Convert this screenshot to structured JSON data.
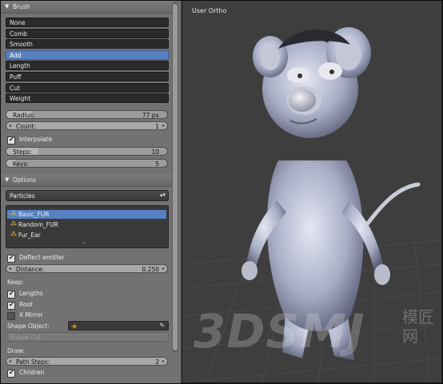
{
  "panel": {
    "brush_header": "Brush",
    "tools": [
      "None",
      "Comb",
      "Smooth",
      "Add",
      "Length",
      "Puff",
      "Cut",
      "Weight"
    ],
    "selected_tool": 3,
    "radius": {
      "label": "Radius:",
      "value": "77 px",
      "fraction": 0.16
    },
    "count": {
      "label": "Count:",
      "value": "1"
    },
    "interpolate": {
      "label": "Interpolate",
      "checked": true
    },
    "steps": {
      "label": "Steps:",
      "value": "10",
      "fraction": 0.2
    },
    "keys": {
      "label": "Keys:",
      "value": "5",
      "fraction": 0.06
    },
    "options_header": "Options",
    "mode_select": "Particles",
    "particle_systems": [
      "Basic_FUR",
      "Random_FUR",
      "Fur_Ear"
    ],
    "deflect_emitter": {
      "label": "Deflect emitter",
      "checked": true
    },
    "distance": {
      "label": "Distance:",
      "value": "0.250"
    },
    "keep_label": "Keep:",
    "lengths": {
      "label": "Lengths",
      "checked": true
    },
    "root": {
      "label": "Root",
      "checked": true
    },
    "x_mirror": {
      "label": "X Mirror",
      "checked": false
    },
    "shape_object_label": "Shape Object:",
    "shape_cut_label": "Shape Cut",
    "draw_label": "Draw:",
    "path_steps": {
      "label": "Path Steps:",
      "value": "2"
    },
    "children": {
      "label": "Children",
      "checked": true
    }
  },
  "viewport": {
    "title": "User Ortho",
    "watermark": "3DSMJ",
    "watermark_cn": "模匠网"
  },
  "colors": {
    "accent": "#5680c2",
    "panel": "#727272",
    "viewport": "#3e3e3e"
  }
}
